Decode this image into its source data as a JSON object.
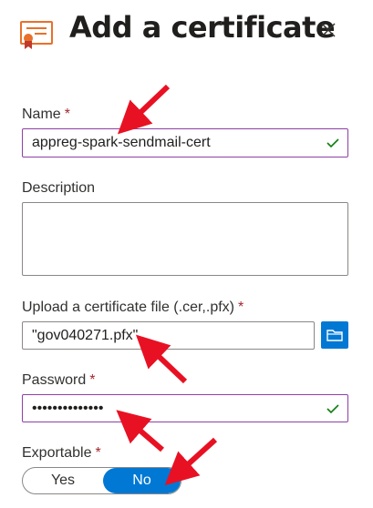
{
  "header": {
    "title": "Add a certificate",
    "icon": "certificate-icon",
    "close_icon": "close-icon"
  },
  "form": {
    "name": {
      "label": "Name",
      "required_mark": "*",
      "value": "appreg-spark-sendmail-cert",
      "valid": true
    },
    "description": {
      "label": "Description",
      "value": ""
    },
    "upload": {
      "label": "Upload a certificate file (.cer,.pfx)",
      "required_mark": "*",
      "value": "\"gov040271.pfx\"",
      "browse_icon": "folder-icon"
    },
    "password": {
      "label": "Password",
      "required_mark": "*",
      "value": "••••••••••••••",
      "valid": true
    },
    "exportable": {
      "label": "Exportable",
      "required_mark": "*",
      "options": [
        "Yes",
        "No"
      ],
      "selected": "No"
    }
  },
  "colors": {
    "accent": "#0078d4",
    "focus_border": "#8d3fa3",
    "required": "#a4262c",
    "valid_check": "#107c10",
    "annotation_arrow": "#e81123",
    "cert_orange": "#e8702a"
  }
}
